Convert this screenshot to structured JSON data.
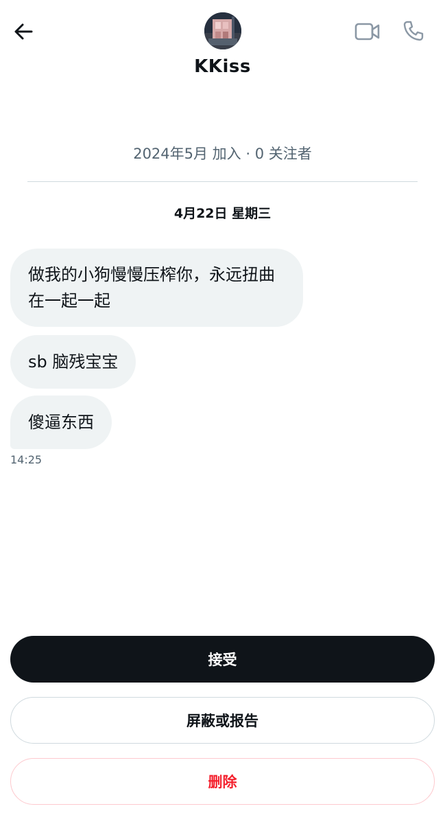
{
  "header": {
    "back_icon": "arrow-left-icon",
    "display_name": "KKiss",
    "video_call_icon": "video-camera-icon",
    "voice_call_icon": "phone-icon"
  },
  "profile": {
    "joined": "2024年5月 加入",
    "separator": "·",
    "followers": "0 关注者"
  },
  "conversation": {
    "date_label": "4月22日 星期三",
    "messages": [
      {
        "text": "做我的小狗慢慢压榨你，永远扭曲在一起一起"
      },
      {
        "text": "sb 脑残宝宝"
      },
      {
        "text": "傻逼东西"
      }
    ],
    "last_timestamp": "14:25"
  },
  "actions": {
    "accept_label": "接受",
    "block_report_label": "屏蔽或报告",
    "delete_label": "删除"
  },
  "colors": {
    "text_primary": "#0f1419",
    "text_secondary": "#536471",
    "bubble_bg": "#eff3f4",
    "divider": "#cfd9de",
    "danger": "#f4212e",
    "accept_bg": "#0f1419"
  }
}
